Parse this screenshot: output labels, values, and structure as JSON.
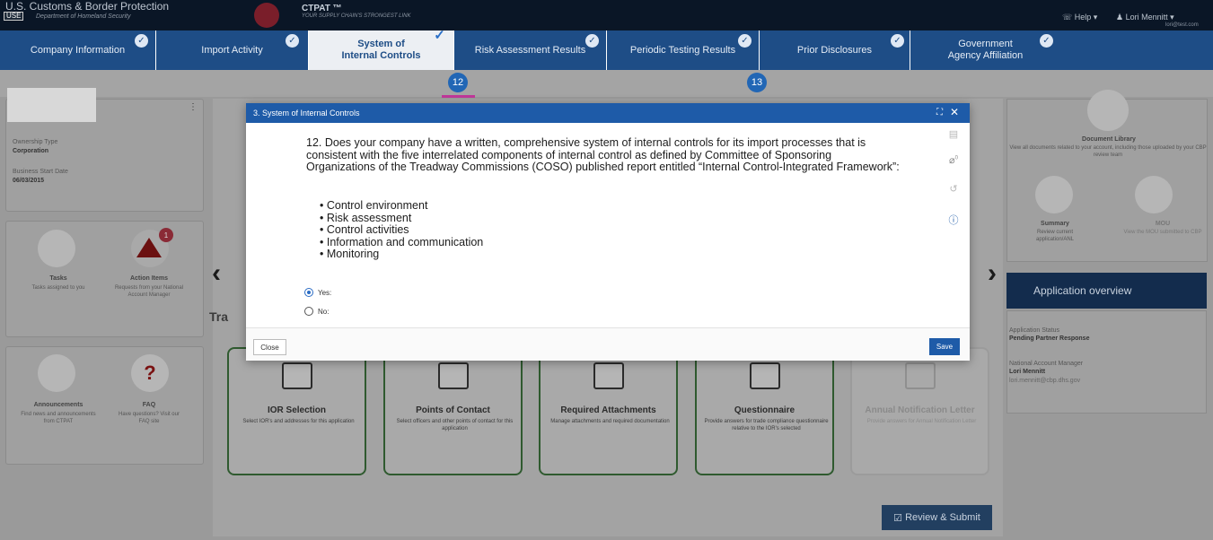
{
  "header": {
    "agency": "U.S. Customs & Border Protection",
    "agency_sub": "Department of Homeland Security",
    "back_label": "USE",
    "program": "CTPAT ™",
    "program_sub": "YOUR SUPPLY CHAIN'S STRONGEST LINK",
    "help": "Help ▾",
    "user": "Lori Mennitt ▾",
    "user_email": "lori@test.com"
  },
  "tabs": [
    {
      "label": "Company Information"
    },
    {
      "label": "Import Activity"
    },
    {
      "label": "System of Internal Controls"
    },
    {
      "label": "Risk Assessment Results"
    },
    {
      "label": "Periodic Testing Results"
    },
    {
      "label": "Prior Disclosures"
    },
    {
      "label": "Government Agency Affiliation"
    }
  ],
  "steps": [
    "12",
    "13"
  ],
  "left": {
    "ownership_label": "Ownership Type",
    "ownership_value": "Corporation",
    "start_label": "Business Start Date",
    "start_value": "06/03/2015",
    "tasks_title": "Tasks",
    "tasks_desc": "Tasks assigned to you",
    "action_title": "Action Items",
    "action_desc": "Requests from your National Account Manager",
    "action_badge": "1",
    "ann_title": "Announcements",
    "ann_desc": "Find news and announcements from CTPAT",
    "faq_title": "FAQ",
    "faq_desc": "Have questions? Visit our FAQ site"
  },
  "main": {
    "track_label": "Tra",
    "tiles": [
      {
        "title": "IOR Selection",
        "desc": "Select IOR's and addresses for this application"
      },
      {
        "title": "Points of Contact",
        "desc": "Select officers and other points of contact for this application"
      },
      {
        "title": "Required Attachments",
        "desc": "Manage attachments and required documentation"
      },
      {
        "title": "Questionnaire",
        "desc": "Provide answers for trade compliance questionnaire relative to the IOR's selected"
      },
      {
        "title": "Annual Notification Letter",
        "desc": "Provide answers for Annual Notification Letter"
      }
    ],
    "review_label": "Review & Submit"
  },
  "right": {
    "doclib_title": "Document Library",
    "doclib_desc": "View all documents related to your account, including those uploaded by your CBP review team",
    "summary_title": "Summary",
    "summary_desc": "Review current application/ANL",
    "mou_title": "MOU",
    "mou_desc": "View the MOU submitted to CBP",
    "overview_title": "Application overview",
    "status_label": "Application Status",
    "status_value": "Pending Partner Response",
    "nam_label": "National Account Manager",
    "nam_value": "Lori Mennitt",
    "nam_email": "lori.mennitt@cbp.dhs.gov"
  },
  "modal": {
    "title": "3. System of Internal Controls",
    "question": "12. Does your company have a written, comprehensive system of internal controls for its import processes that is consistent with the five interrelated components of internal control as defined by Committee of Sponsoring Organizations of the Treadway Commissions (COSO) published report entitled “Internal Control-Integrated Framework”:",
    "bullets": [
      "Control environment",
      "Risk assessment",
      "Control activities",
      "Information and communication",
      "Monitoring"
    ],
    "options": [
      {
        "label": "Yes:",
        "selected": true
      },
      {
        "label": "No:",
        "selected": false
      }
    ],
    "attachment_count": "0",
    "close_label": "Close",
    "save_label": "Save"
  },
  "colors": {
    "primary": "#1e5ba8",
    "tab_bar": "#1e4d86",
    "step": "#2166b5"
  }
}
